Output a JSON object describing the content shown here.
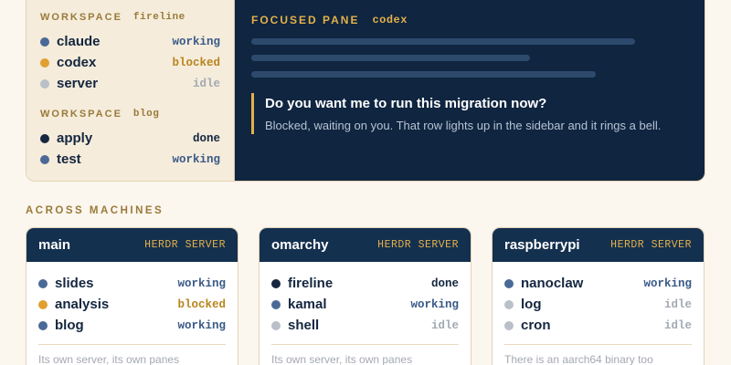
{
  "sidebar": {
    "workspaces": [
      {
        "label": "WORKSPACE",
        "name": "fireline",
        "items": [
          {
            "name": "claude",
            "status": "working"
          },
          {
            "name": "codex",
            "status": "blocked"
          },
          {
            "name": "server",
            "status": "idle"
          }
        ]
      },
      {
        "label": "WORKSPACE",
        "name": "blog",
        "items": [
          {
            "name": "apply",
            "status": "done"
          },
          {
            "name": "test",
            "status": "working"
          }
        ]
      }
    ]
  },
  "focused": {
    "label": "FOCUSED PANE",
    "pane": "codex",
    "question": "Do you want me to run this migration now?",
    "note": "Blocked, waiting on you. That row lights up in the sidebar and it rings a bell."
  },
  "machines_section": {
    "title": "ACROSS MACHINES"
  },
  "machines": [
    {
      "name": "main",
      "role": "HERDR SERVER",
      "items": [
        {
          "name": "slides",
          "status": "working"
        },
        {
          "name": "analysis",
          "status": "blocked"
        },
        {
          "name": "blog",
          "status": "working"
        }
      ],
      "note": "Its own server, its own panes"
    },
    {
      "name": "omarchy",
      "role": "HERDR SERVER",
      "items": [
        {
          "name": "fireline",
          "status": "done"
        },
        {
          "name": "kamal",
          "status": "working"
        },
        {
          "name": "shell",
          "status": "idle"
        }
      ],
      "note": "Its own server, its own panes"
    },
    {
      "name": "raspberrypi",
      "role": "HERDR SERVER",
      "items": [
        {
          "name": "nanoclaw",
          "status": "working"
        },
        {
          "name": "log",
          "status": "idle"
        },
        {
          "name": "cron",
          "status": "idle"
        }
      ],
      "note": "There is an aarch64 binary too"
    }
  ],
  "colors": {
    "working": "#4a6a96",
    "blocked": "#e0a030",
    "idle": "#b9c0c8",
    "done": "#16273f",
    "accent": "#e4b04a",
    "navy": "#0f2540"
  }
}
